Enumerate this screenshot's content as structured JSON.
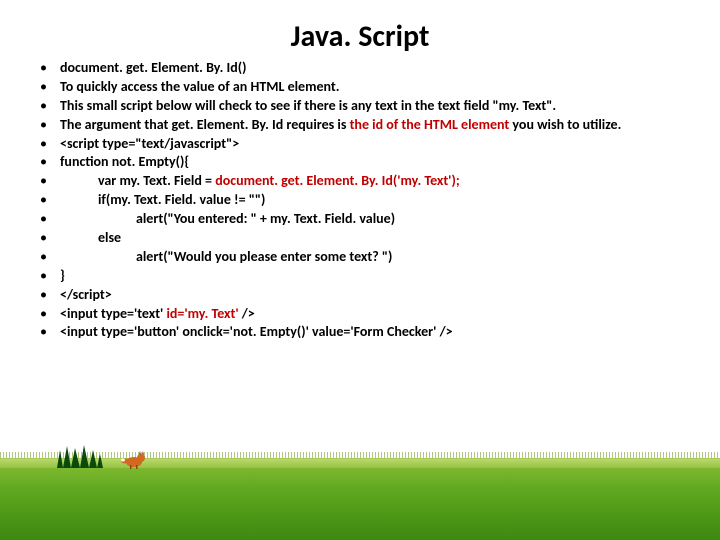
{
  "title": "Java. Script",
  "bullets": [
    {
      "segments": [
        {
          "text": "document. get. Element. By. Id()"
        }
      ]
    },
    {
      "segments": [
        {
          "text": "To quickly access the value of an HTML element."
        }
      ]
    },
    {
      "segments": [
        {
          "text": "This small script below will check to see if there is any text in the text field \"my. Text\"."
        }
      ]
    },
    {
      "segments": [
        {
          "text": "The argument that get. Element. By. Id requires is "
        },
        {
          "text": "the id of the HTML element",
          "red": true
        },
        {
          "text": " you wish to utilize."
        }
      ]
    },
    {
      "segments": [
        {
          "text": "<script type=\"text/javascript\">"
        }
      ]
    },
    {
      "segments": [
        {
          "text": "function not. Empty(){"
        }
      ]
    },
    {
      "segments": [
        {
          "text": "            var my. Text. Field = "
        },
        {
          "text": "document. get. Element. By. Id('my. Text');",
          "red": true
        }
      ]
    },
    {
      "segments": [
        {
          "text": "            if(my. Text. Field. value != \"\")"
        }
      ]
    },
    {
      "segments": [
        {
          "text": "                        alert(\"You entered: \" + my. Text. Field. value)"
        }
      ]
    },
    {
      "segments": [
        {
          "text": "            else"
        }
      ]
    },
    {
      "segments": [
        {
          "text": "                        alert(\"Would you please enter some text? \")"
        }
      ]
    },
    {
      "segments": [
        {
          "text": "}"
        }
      ]
    },
    {
      "segments": [
        {
          "text": "</script>"
        }
      ]
    },
    {
      "segments": [
        {
          "text": "<input type='text' "
        },
        {
          "text": "id='my. Text'",
          "red": true
        },
        {
          "text": " />"
        }
      ]
    },
    {
      "segments": [
        {
          "text": "<input type='button' onclick='not. Empty()' value='Form Checker' />"
        }
      ]
    }
  ]
}
